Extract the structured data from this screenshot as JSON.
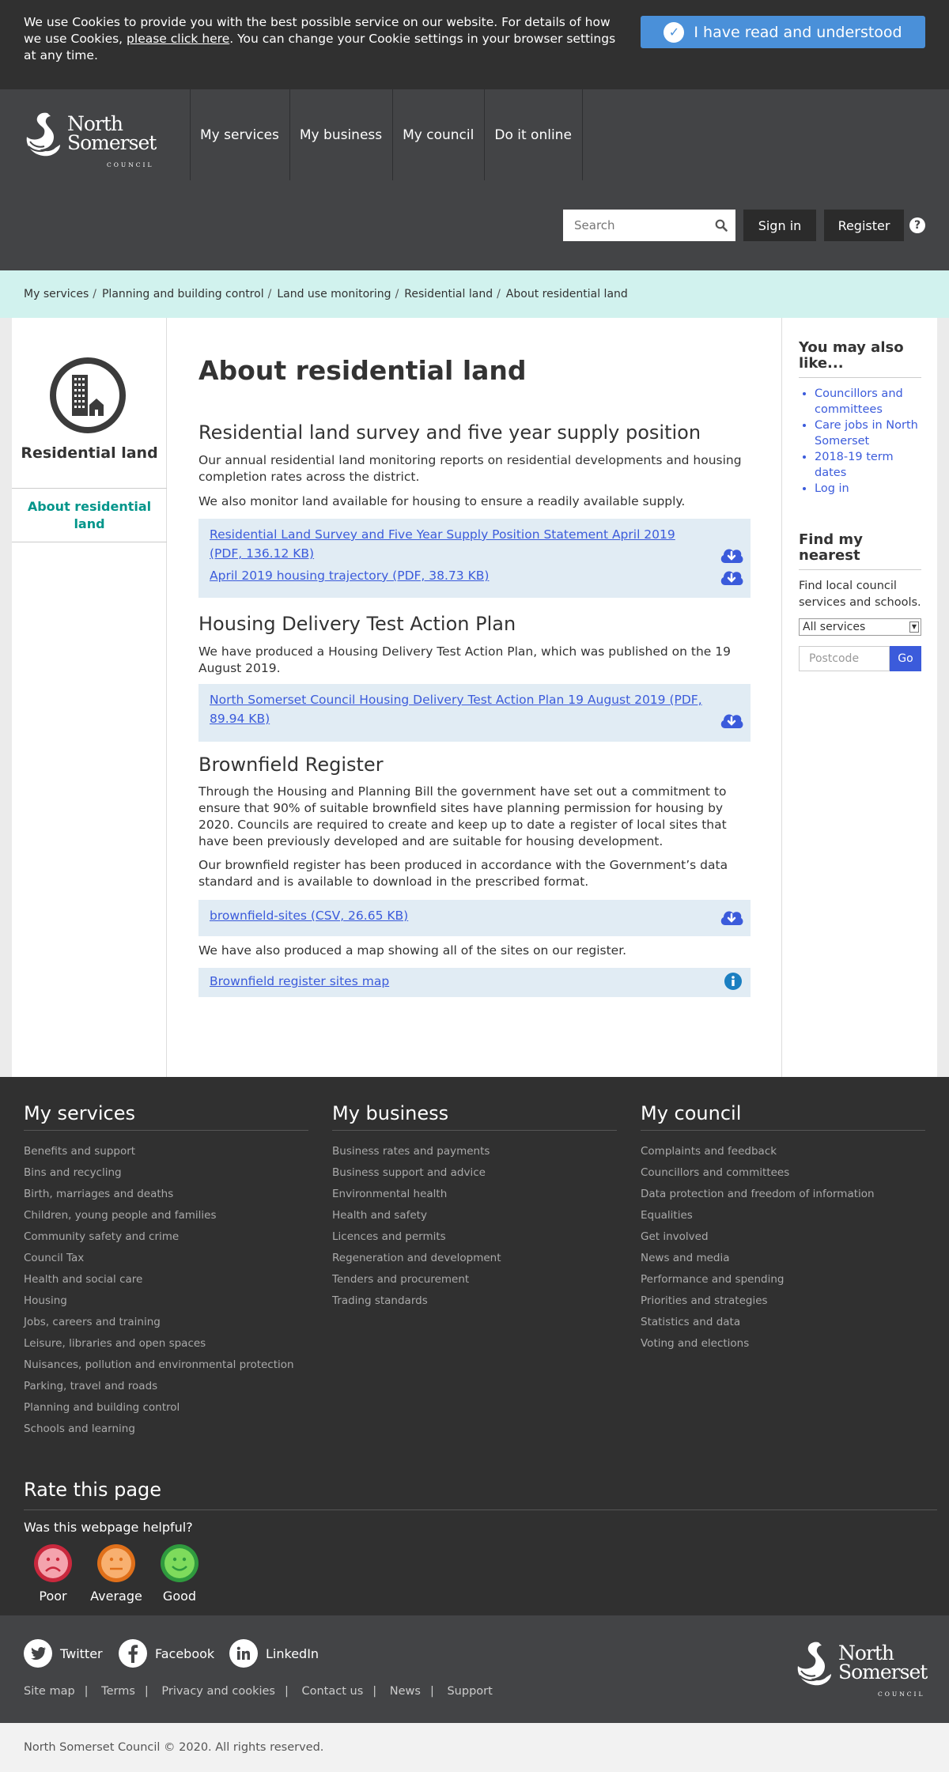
{
  "cookie": {
    "text_before": "We use Cookies to provide you with the best possible service on our website. For details of how we use Cookies, ",
    "link": "please click here",
    "text_after": ". You can change your Cookie settings in your browser settings at any time.",
    "button": "I have read and understood"
  },
  "logo": {
    "line1": "North",
    "line2": "Somerset",
    "line3": "COUNCIL"
  },
  "nav": [
    "My services",
    "My business",
    "My council",
    "Do it online"
  ],
  "search": {
    "placeholder": "Search"
  },
  "header_buttons": {
    "sign_in": "Sign in",
    "register": "Register",
    "help": "?"
  },
  "breadcrumb": [
    "My services",
    "Planning and building control",
    "Land use monitoring",
    "Residential land",
    "About residential land"
  ],
  "breadcrumb_sep": "/",
  "sidebar": {
    "title": "Residential land",
    "link": "About residential land"
  },
  "main": {
    "title": "About residential land",
    "s1_heading": "Residential land survey and five year supply position",
    "s1_p1": "Our annual residential land monitoring reports on residential developments and housing completion rates across the district.",
    "s1_p2": "We also monitor land available for housing to ensure a readily available supply.",
    "s1_links": [
      "Residential Land Survey and Five Year Supply Position Statement April 2019 (PDF, 136.12 KB)",
      "April 2019 housing trajectory (PDF, 38.73 KB)"
    ],
    "s2_heading": "Housing Delivery Test Action Plan",
    "s2_p1": "We have produced a Housing Delivery Test Action Plan, which was published on the 19 August 2019.",
    "s2_links": [
      "North Somerset Council Housing Delivery Test Action Plan 19 August 2019 (PDF, 89.94 KB)"
    ],
    "s3_heading": "Brownfield Register",
    "s3_p1": "Through the Housing and Planning Bill the government have set out a commitment to ensure that 90% of suitable brownfield sites have planning permission for housing by 2020. Councils are required to create and keep up to date a register of local sites that have been previously developed and are suitable for housing development.",
    "s3_p2": "Our brownfield register has been produced in accordance with the Government’s data standard and is available to download in the prescribed format.",
    "s3_link": "brownfield-sites (CSV, 26.65 KB)",
    "s3_p3": "We have also produced a map showing all of the sites on our register.",
    "s3_map_link": "Brownfield register sites map"
  },
  "right": {
    "also_heading": "You may also like...",
    "also_links": [
      "Councillors and committees",
      "Care jobs in North Somerset",
      "2018-19 term dates",
      "Log in"
    ],
    "nearest_heading": "Find my nearest",
    "nearest_text": "Find local council services and schools.",
    "select_value": "All services",
    "postcode_placeholder": "Postcode",
    "go": "Go"
  },
  "footer": {
    "services": {
      "heading": "My services",
      "items": [
        "Benefits and support",
        "Bins and recycling",
        "Birth, marriages and deaths",
        "Children, young people and families",
        "Community safety and crime",
        "Council Tax",
        "Health and social care",
        "Housing",
        "Jobs, careers and training",
        "Leisure, libraries and open spaces",
        "Nuisances, pollution and environmental protection",
        "Parking, travel and roads",
        "Planning and building control",
        "Schools and learning"
      ]
    },
    "business": {
      "heading": "My business",
      "items": [
        "Business rates and payments",
        "Business support and advice",
        "Environmental health",
        "Health and safety",
        "Licences and permits",
        "Regeneration and development",
        "Tenders and procurement",
        "Trading standards"
      ]
    },
    "council": {
      "heading": "My council",
      "items": [
        "Complaints and feedback",
        "Councillors and committees",
        "Data protection and freedom of information",
        "Equalities",
        "Get involved",
        "News and media",
        "Performance and spending",
        "Priorities and strategies",
        "Statistics and data",
        "Voting and elections"
      ]
    }
  },
  "rate": {
    "heading": "Rate this page",
    "question": "Was this webpage helpful?",
    "options": [
      "Poor",
      "Average",
      "Good"
    ]
  },
  "colors": {
    "poor": "#e8334a",
    "average": "#f58a2a",
    "good": "#3cb54a"
  },
  "social": [
    "Twitter",
    "Facebook",
    "LinkedIn"
  ],
  "footer_links": [
    "Site map",
    "Terms",
    "Privacy and cookies",
    "Contact us",
    "News",
    "Support"
  ],
  "copyright": "North Somerset Council © 2020. All rights reserved."
}
